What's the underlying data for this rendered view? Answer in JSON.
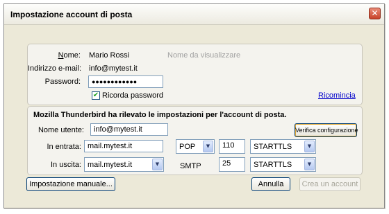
{
  "window": {
    "title": "Impostazione account di posta",
    "close_glyph": "✕"
  },
  "identity": {
    "name_label": "Nome:",
    "name_value": "Mario Rossi",
    "name_hint": "Nome da visualizzare",
    "email_label": "Indirizzo e-mail:",
    "email_value": "info@mytest.it",
    "password_label": "Password:",
    "password_value": "●●●●●●●●●●●●",
    "remember_label": "Ricorda password",
    "remember_checked": true,
    "restart_link": "Ricomincia"
  },
  "server": {
    "heading": "Mozilla Thunderbird ha rilevato le impostazioni per l'account di posta.",
    "username_label": "Nome utente:",
    "username_value": "info@mytest.it",
    "verify_button": "Verifica configurazione",
    "incoming_label": "In entrata:",
    "incoming_host": "mail.mytest.it",
    "incoming_protocol": "POP",
    "incoming_port": "110",
    "incoming_security": "STARTTLS",
    "outgoing_label": "In uscita:",
    "outgoing_host": "mail.mytest.it",
    "outgoing_protocol": "SMTP",
    "outgoing_port": "25",
    "outgoing_security": "STARTTLS"
  },
  "footer": {
    "manual_button": "Impostazione manuale...",
    "cancel_button": "Annulla",
    "create_button": "Crea un account"
  },
  "icons": {
    "dropdown": "▼",
    "check": "✔"
  }
}
